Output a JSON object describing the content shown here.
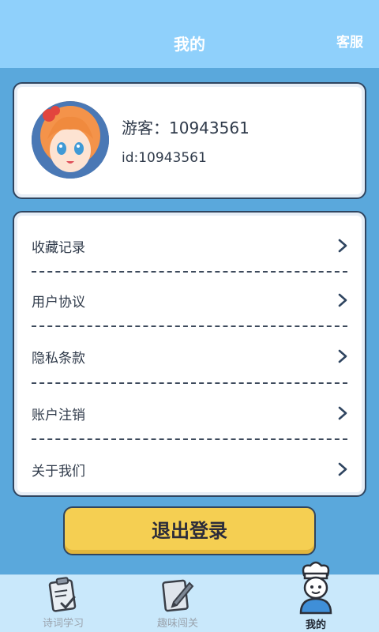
{
  "header": {
    "title": "我的",
    "service_label": "客服"
  },
  "profile": {
    "nickname": "游客：10943561",
    "id_text": "id:10943561"
  },
  "menu": {
    "items": [
      {
        "label": "收藏记录"
      },
      {
        "label": "用户协议"
      },
      {
        "label": "隐私条款"
      },
      {
        "label": "账户注销"
      },
      {
        "label": "关于我们"
      }
    ]
  },
  "logout": {
    "label": "退出登录"
  },
  "tabbar": {
    "tabs": [
      {
        "label": "诗词学习",
        "icon": "clipboard-check-icon",
        "active": false
      },
      {
        "label": "趣味闯关",
        "icon": "notepad-pencil-icon",
        "active": false
      },
      {
        "label": "我的",
        "icon": "chef-avatar-icon",
        "active": true
      }
    ]
  },
  "colors": {
    "header_bg": "#8fd0fb",
    "page_bg": "#5aa8dc",
    "button_yellow": "#f5cf52",
    "tabbar_bg": "#c9e8fb"
  }
}
